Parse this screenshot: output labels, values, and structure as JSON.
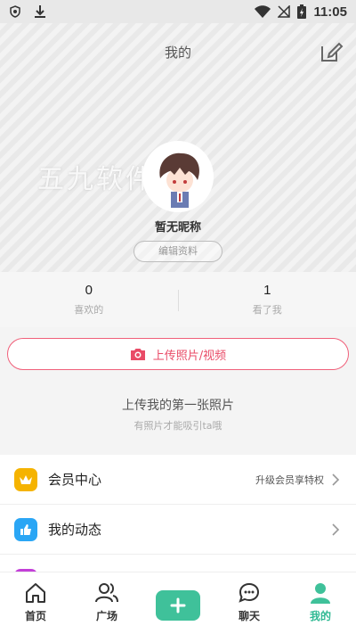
{
  "status_bar": {
    "time": "11:05"
  },
  "header": {
    "title": "我的"
  },
  "profile": {
    "nickname": "暂无昵称",
    "edit_profile_label": "编辑资料",
    "watermark": "五九软件"
  },
  "stats": [
    {
      "value": "0",
      "label": "喜欢的"
    },
    {
      "value": "1",
      "label": "看了我"
    }
  ],
  "upload": {
    "label": "上传照片/视频"
  },
  "empty_state": {
    "title": "上传我的第一张照片",
    "subtitle": "有照片才能吸引ta哦"
  },
  "menu": [
    {
      "label": "会员中心",
      "extra": "升级会员享特权",
      "icon": "crown-icon",
      "color": "#f5b300"
    },
    {
      "label": "我的动态",
      "extra": "",
      "icon": "thumbs-up-icon",
      "color": "#2aa6f5"
    }
  ],
  "bottom_nav": {
    "home": "首页",
    "square": "广场",
    "chat": "聊天",
    "mine": "我的"
  },
  "colors": {
    "accent_green": "#3fc19a",
    "accent_pink": "#e94b67"
  }
}
